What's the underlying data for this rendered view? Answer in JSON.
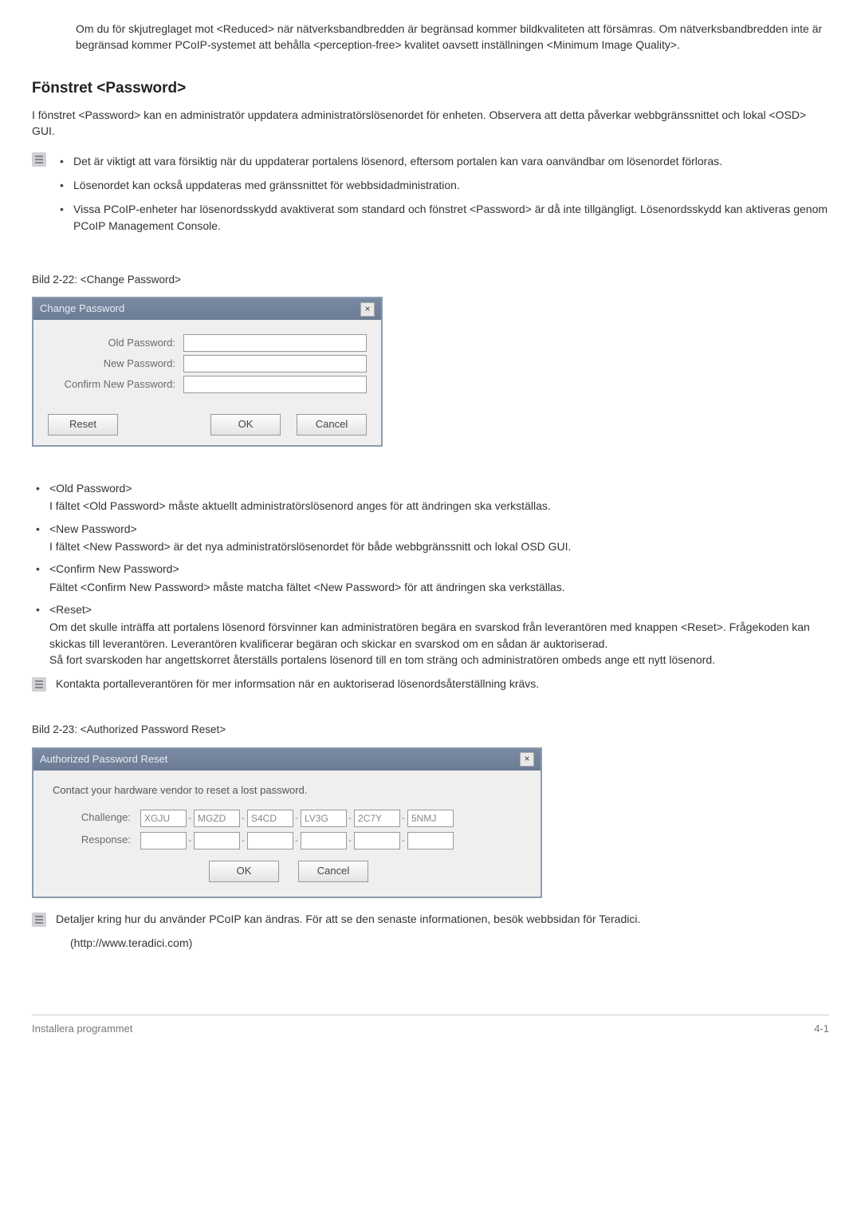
{
  "intro_paragraph": "Om du för skjutreglaget mot <Reduced> när nätverksbandbredden är begränsad kommer bildkvaliteten att försämras. Om nätverksbandbredden inte är begränsad kommer PCoIP-systemet att behålla <perception-free> kvalitet oavsett inställningen <Minimum Image Quality>.",
  "section_heading": "Fönstret <Password>",
  "section_intro": "I fönstret <Password> kan en administratör uppdatera administratörslösenordet för enheten. Observera att detta påverkar webbgränssnittet och lokal <OSD> GUI.",
  "warning_bullets": [
    "Det är viktigt att vara försiktig när du uppdaterar portalens lösenord, eftersom portalen kan vara oanvändbar om lösenordet förloras.",
    "Lösenordet kan också uppdateras med gränssnittet för webbsidadministration.",
    "Vissa PCoIP-enheter har lösenordsskydd avaktiverat som standard och fönstret <Password> är då inte tillgängligt. Lösenordsskydd kan aktiveras genom PCoIP Management Console."
  ],
  "figure1_caption": "Bild 2-22: <Change Password>",
  "change_password_window": {
    "title": "Change Password",
    "close_label": "×",
    "old_label": "Old Password:",
    "new_label": "New Password:",
    "confirm_label": "Confirm New Password:",
    "old_value": "",
    "new_value": "",
    "confirm_value": "",
    "reset_btn": "Reset",
    "ok_btn": "OK",
    "cancel_btn": "Cancel"
  },
  "fields": [
    {
      "term": "<Old Password>",
      "desc": "I fältet <Old Password> måste aktuellt administratörslösenord anges för att ändringen ska verkställas."
    },
    {
      "term": "<New Password>",
      "desc": "I fältet <New Password> är det nya administratörslösenordet för både webbgränssnitt och lokal OSD GUI."
    },
    {
      "term": "<Confirm New Password>",
      "desc": "Fältet <Confirm New Password> måste matcha fältet <New Password> för att ändringen ska verkställas."
    },
    {
      "term": "<Reset>",
      "desc": "Om det skulle inträffa att portalens lösenord försvinner kan administratören begära en svarskod från leverantören med knappen <Reset>. Frågekoden kan skickas till leverantören. Leverantören kvalificerar begäran och skickar en svarskod om en sådan är auktoriserad.",
      "desc2": "Så fort svarskoden har angettskorret återställs portalens lösenord till en tom sträng och administratören ombeds ange ett nytt lösenord."
    }
  ],
  "contact_note": "Kontakta portalleverantören för mer informsation när en auktoriserad lösenordsåterställning krävs.",
  "figure2_caption": "Bild 2-23: <Authorized Password Reset>",
  "apr_window": {
    "title": "Authorized Password Reset",
    "close_label": "×",
    "instruction": "Contact your hardware vendor to reset a lost password.",
    "challenge_label": "Challenge:",
    "response_label": "Response:",
    "challenge": [
      "XGJU",
      "MGZD",
      "S4CD",
      "LV3G",
      "2C7Y",
      "5NMJ"
    ],
    "response": [
      "",
      "",
      "",
      "",
      "",
      ""
    ],
    "ok_btn": "OK",
    "cancel_btn": "Cancel"
  },
  "details_note_1": "Detaljer kring hur du använder PCoIP kan ändras. För att se den senaste informationen, besök webbsidan för Teradici.",
  "details_note_2": "(http://www.teradici.com)",
  "footer_left": "Installera programmet",
  "footer_right": "4-1"
}
